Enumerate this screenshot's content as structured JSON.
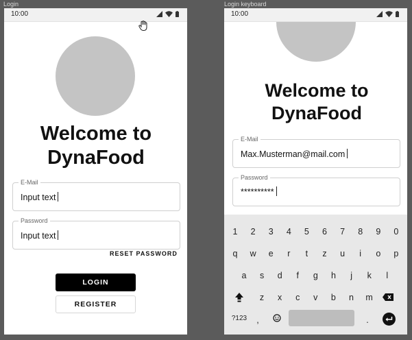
{
  "frames": [
    {
      "label": "Login"
    },
    {
      "label": "Login keyboard"
    }
  ],
  "status_bar": {
    "time": "10:00"
  },
  "login": {
    "title": "Welcome to DynaFood",
    "email_label": "E-Mail",
    "email_value": "Input text",
    "password_label": "Password",
    "password_value": "Input text",
    "reset_password_label": "RESET PASSWORD",
    "login_label": "LOGIN",
    "register_label": "REGISTER"
  },
  "login_keyboard": {
    "title": "Welcome to DynaFood",
    "email_label": "E-Mail",
    "email_value": "Max.Musterman@mail.com",
    "password_label": "Password",
    "password_value": "**********"
  },
  "keyboard": {
    "row1": [
      "1",
      "2",
      "3",
      "4",
      "5",
      "6",
      "7",
      "8",
      "9",
      "0"
    ],
    "row2": [
      "q",
      "w",
      "e",
      "r",
      "t",
      "z",
      "u",
      "i",
      "o",
      "p"
    ],
    "row3": [
      "a",
      "s",
      "d",
      "f",
      "g",
      "h",
      "j",
      "k",
      "l"
    ],
    "row4": [
      "z",
      "x",
      "c",
      "v",
      "b",
      "n",
      "m"
    ],
    "symbols_label": "?123",
    "comma": ",",
    "period": "."
  },
  "colors": {
    "primary_button": "#000000",
    "avatar_placeholder": "#c4c4c4",
    "keyboard_bg": "#e8e8e8"
  },
  "icons": [
    "signal-icon",
    "wifi-icon",
    "battery-icon",
    "hand-cursor-icon",
    "shift-icon",
    "backspace-icon",
    "emoji-icon",
    "enter-icon"
  ]
}
